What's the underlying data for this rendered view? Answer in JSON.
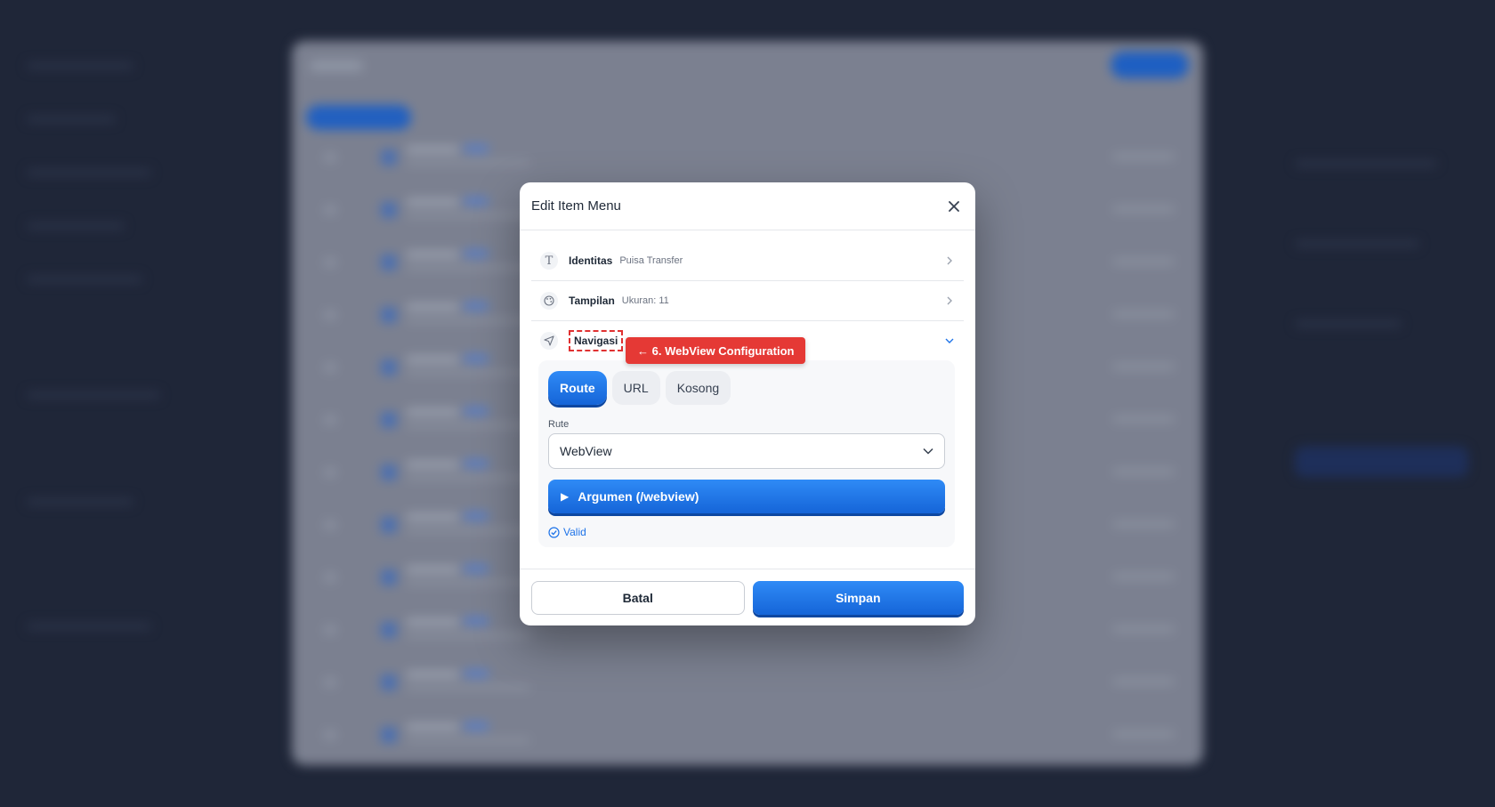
{
  "modal": {
    "title": "Edit Item Menu",
    "sections": [
      {
        "label": "Identitas",
        "summary": "Puisa Transfer",
        "icon": "text-icon"
      },
      {
        "label": "Tampilan",
        "summary": "Ukuran: 11",
        "icon": "palette-icon"
      },
      {
        "label": "Navigasi",
        "summary": "",
        "icon": "navigation-icon",
        "expanded": true
      }
    ],
    "annotation": "← 6. WebView Configuration",
    "navigation": {
      "modes": [
        "Route",
        "URL",
        "Kosong"
      ],
      "active_mode": "Route",
      "route_label": "Rute",
      "route_value": "WebView",
      "args_button": "Argumen (/webview)",
      "status": "Valid"
    },
    "footer": {
      "cancel": "Batal",
      "save": "Simpan"
    }
  },
  "colors": {
    "accent": "#1e73e8",
    "annotation": "#e53935",
    "overlay": "#1f2638"
  }
}
